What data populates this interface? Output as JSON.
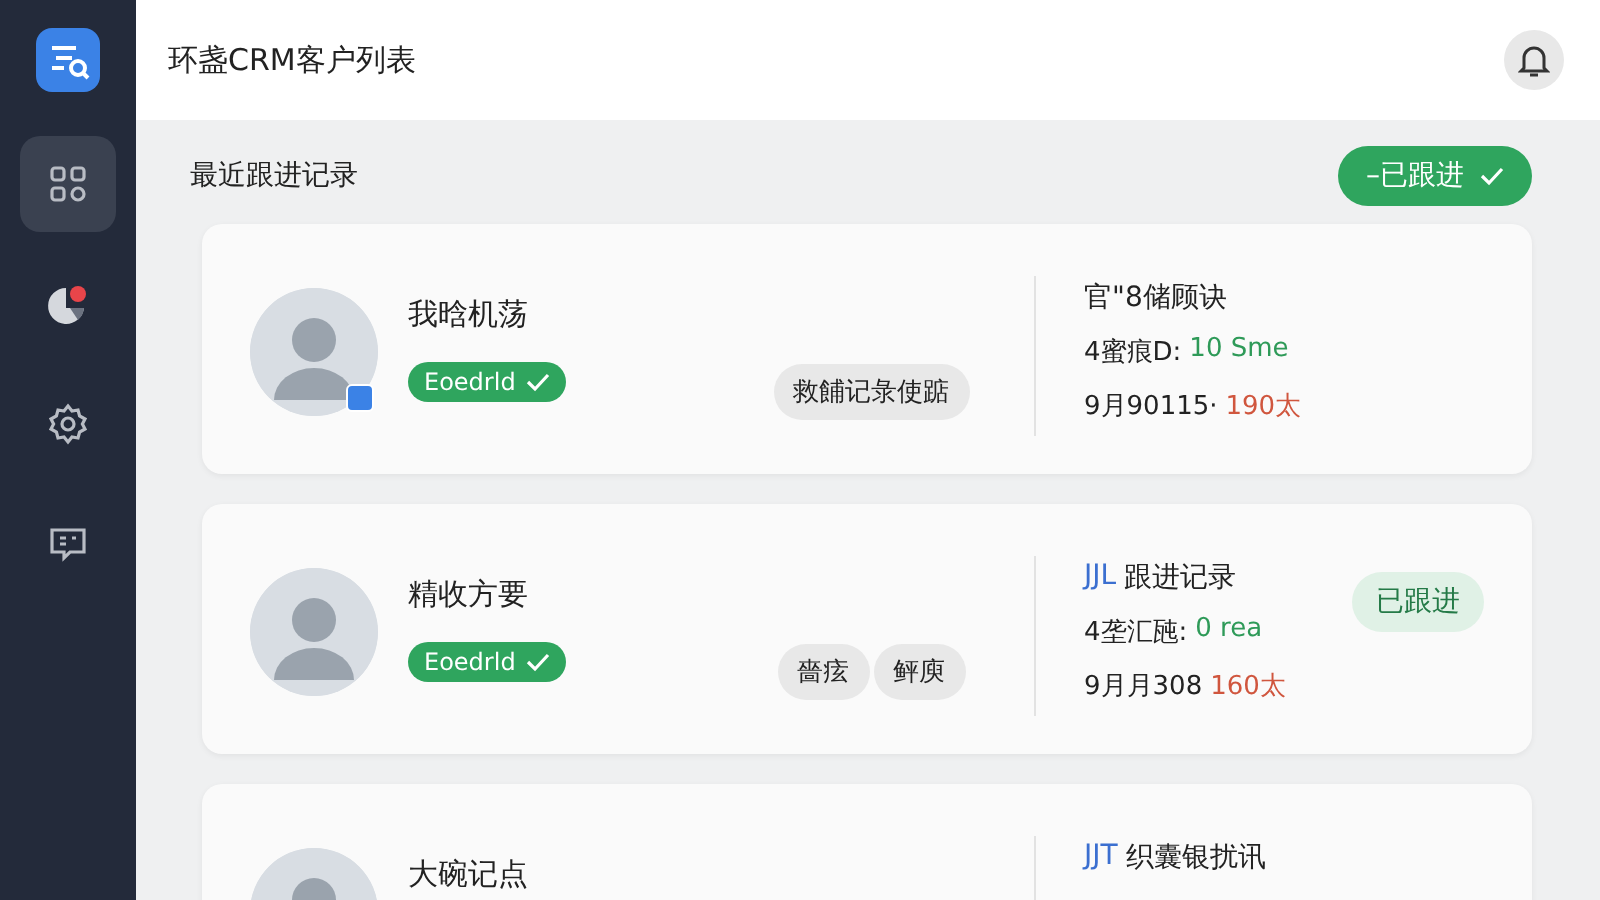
{
  "header": {
    "title": "环盏CRM客户列表"
  },
  "sidebar": {
    "items": [
      {
        "kind": "grid",
        "selected": true
      },
      {
        "kind": "chart",
        "selected": false
      },
      {
        "kind": "settings",
        "selected": false
      },
      {
        "kind": "message",
        "selected": false
      }
    ]
  },
  "section": {
    "title": "最近跟进记录",
    "filter_button": {
      "label": "–已跟进",
      "checked": true
    }
  },
  "cards": [
    {
      "name": "我晗机荡",
      "avatar_badge": true,
      "status": {
        "label": "Eoedrld",
        "checked": true
      },
      "tags": [
        "救餔记彔使踮"
      ],
      "title": "官\"8储顾诀",
      "detail_label": "4蜜痕D:",
      "detail_value": "10 Sme",
      "date": "9月90115·",
      "date_value": "190太"
    },
    {
      "name": "精收方要",
      "avatar_badge": false,
      "status": {
        "label": "Eoedrld",
        "checked": true
      },
      "tags": [
        "嗇痃",
        "鲆庾"
      ],
      "title_prefix": "JJL",
      "title": "跟进记录",
      "detail_label": "4垄汇瓲:",
      "detail_value": "0 rea",
      "date": "9月月308",
      "date_value": "160太",
      "follow_badge": "已跟进"
    },
    {
      "name": "大碗记点",
      "avatar_badge": false,
      "title_prefix": "JJT",
      "title": "织囊银扰讯"
    }
  ]
}
